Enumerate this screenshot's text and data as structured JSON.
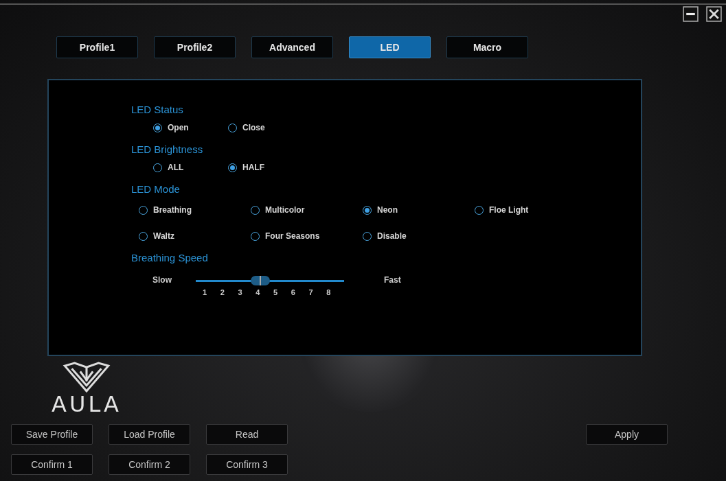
{
  "tabs": [
    {
      "label": "Profile1",
      "selected": false
    },
    {
      "label": "Profile2",
      "selected": false
    },
    {
      "label": "Advanced",
      "selected": false
    },
    {
      "label": "LED",
      "selected": true
    },
    {
      "label": "Macro",
      "selected": false
    }
  ],
  "sections": [
    {
      "kind": "radio",
      "title": "LED Status",
      "options": [
        {
          "label": "Open",
          "selected": true
        },
        {
          "label": "Close",
          "selected": false
        }
      ]
    },
    {
      "kind": "radio",
      "title": "LED Brightness",
      "options": [
        {
          "label": "ALL",
          "selected": false
        },
        {
          "label": "HALF",
          "selected": true
        }
      ]
    },
    {
      "kind": "radio-grid",
      "title": "LED Mode",
      "options": [
        {
          "label": "Breathing",
          "selected": false
        },
        {
          "label": "Multicolor",
          "selected": false
        },
        {
          "label": "Neon",
          "selected": true
        },
        {
          "label": "Floe Light",
          "selected": false
        },
        {
          "label": "Waltz",
          "selected": false
        },
        {
          "label": "Four Seasons",
          "selected": false
        },
        {
          "label": "Disable",
          "selected": false
        }
      ]
    },
    {
      "kind": "slider",
      "title": "Breathing Speed",
      "min_label": "Slow",
      "max_label": "Fast",
      "level": 0.435,
      "ticks": [
        "1",
        "2",
        "3",
        "4",
        "5",
        "6",
        "7",
        "8"
      ]
    }
  ],
  "logo": {
    "text": "AULA"
  },
  "button_rows": [
    [
      "Save Profile",
      "Load Profile",
      "Read"
    ],
    [
      "Confirm 1",
      "Confirm 2",
      "Confirm 3"
    ]
  ],
  "apply_button": "Apply"
}
